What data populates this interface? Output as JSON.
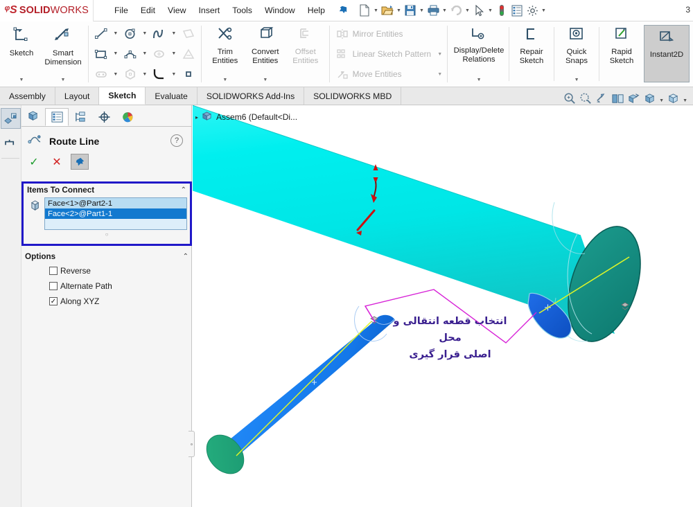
{
  "app": {
    "brand_ds": "2DS",
    "brand_solid": "SOLID",
    "brand_works": "WORKS",
    "far_right_label": "3"
  },
  "menubar": {
    "items": [
      {
        "label": "File",
        "name": "menu-file"
      },
      {
        "label": "Edit",
        "name": "menu-edit"
      },
      {
        "label": "View",
        "name": "menu-view"
      },
      {
        "label": "Insert",
        "name": "menu-insert"
      },
      {
        "label": "Tools",
        "name": "menu-tools"
      },
      {
        "label": "Window",
        "name": "menu-window"
      },
      {
        "label": "Help",
        "name": "menu-help"
      }
    ],
    "pin_icon": "pin-icon",
    "quick_access": [
      {
        "name": "new-document-icon",
        "caret": true
      },
      {
        "name": "open-document-icon",
        "caret": true
      },
      {
        "name": "save-icon",
        "caret": true
      },
      {
        "name": "print-icon",
        "caret": true
      },
      {
        "name": "undo-icon",
        "caret": true
      },
      {
        "name": "select-cursor-icon",
        "caret": true
      },
      {
        "name": "rebuild-traffic-light-icon",
        "caret": false
      },
      {
        "name": "file-properties-icon",
        "caret": false
      },
      {
        "name": "options-gear-icon",
        "caret": true
      }
    ]
  },
  "ribbon": {
    "sketch_group": [
      {
        "label": "Sketch",
        "icon": "sketch-icon",
        "caret": true,
        "dim": false
      },
      {
        "label": "Smart\nDimension",
        "icon": "smart-dimension-icon",
        "caret": true,
        "dim": false
      }
    ],
    "entity_icons": [
      {
        "name": "line-icon",
        "caret": true,
        "dim": false
      },
      {
        "name": "rectangle-icon",
        "caret": true,
        "dim": false
      },
      {
        "name": "slot-icon",
        "caret": true,
        "dim": true
      },
      {
        "name": "circle-icon",
        "caret": true,
        "dim": false
      },
      {
        "name": "arc-icon",
        "caret": true,
        "dim": false
      },
      {
        "name": "polygon-icon",
        "caret": true,
        "dim": true
      },
      {
        "name": "spline-icon",
        "caret": true,
        "dim": false
      },
      {
        "name": "ellipse-icon",
        "caret": true,
        "dim": true
      },
      {
        "name": "fillet-icon",
        "caret": true,
        "dim": false
      },
      {
        "name": "plane-icon",
        "caret": false,
        "dim": true
      },
      {
        "name": "point-icon",
        "caret": false,
        "dim": true
      },
      {
        "name": "sketch-pattern-square-icon",
        "caret": false,
        "dim": false
      }
    ],
    "tools_group": [
      {
        "label": "Trim\nEntities",
        "icon": "trim-entities-icon",
        "caret": true,
        "dim": false
      },
      {
        "label": "Convert\nEntities",
        "icon": "convert-entities-icon",
        "caret": true,
        "dim": false
      },
      {
        "label": "Offset\nEntities",
        "icon": "offset-entities-icon",
        "caret": false,
        "dim": true
      }
    ],
    "text_commands": [
      {
        "label": "Mirror Entities",
        "icon": "mirror-entities-icon",
        "caret": false
      },
      {
        "label": "Linear Sketch Pattern",
        "icon": "linear-sketch-pattern-icon",
        "caret": true
      },
      {
        "label": "Move Entities",
        "icon": "move-entities-icon",
        "caret": true
      }
    ],
    "right_group": [
      {
        "label": "Display/Delete\nRelations",
        "icon": "display-delete-relations-icon",
        "caret": true,
        "selected": false
      },
      {
        "label": "Repair\nSketch",
        "icon": "repair-sketch-icon",
        "caret": false,
        "selected": false
      },
      {
        "label": "Quick\nSnaps",
        "icon": "quick-snaps-icon",
        "caret": true,
        "selected": false
      },
      {
        "label": "Rapid\nSketch",
        "icon": "rapid-sketch-icon",
        "caret": false,
        "selected": false
      },
      {
        "label": "Instant2D",
        "icon": "instant2d-icon",
        "caret": false,
        "selected": true
      }
    ]
  },
  "tabs": [
    {
      "label": "Assembly",
      "active": false
    },
    {
      "label": "Layout",
      "active": false
    },
    {
      "label": "Sketch",
      "active": true
    },
    {
      "label": "Evaluate",
      "active": false
    },
    {
      "label": "SOLIDWORKS Add-Ins",
      "active": false
    },
    {
      "label": "SOLIDWORKS MBD",
      "active": false
    }
  ],
  "property_manager": {
    "sidebar_buttons": [
      {
        "name": "sidebar-assembly-icon",
        "selected": true
      },
      {
        "name": "sidebar-flyout-tree-icon",
        "selected": false
      }
    ],
    "tabs": [
      {
        "name": "feature-manager-tab",
        "icon": "feature-tree-icon",
        "selected": false
      },
      {
        "name": "property-manager-tab",
        "icon": "property-list-icon",
        "selected": true
      },
      {
        "name": "configuration-manager-tab",
        "icon": "configuration-icon",
        "selected": false
      },
      {
        "name": "dimxpert-manager-tab",
        "icon": "dimxpert-icon",
        "selected": false
      },
      {
        "name": "display-manager-tab",
        "icon": "display-palette-icon",
        "selected": false
      }
    ],
    "title": "Route Line",
    "title_icon": "route-line-icon",
    "help_icon": "help-question-icon",
    "actions": [
      {
        "name": "ok-button",
        "glyph": "✓"
      },
      {
        "name": "cancel-button",
        "glyph": "✕"
      },
      {
        "name": "keep-visible-pin-button",
        "glyph": "✐"
      }
    ],
    "items_to_connect": {
      "header": "Items To Connect",
      "collapse_chevron": "⌃",
      "icon": "selection-face-icon",
      "selections": [
        {
          "label": "Face<1>@Part2-1",
          "state": "selected-light"
        },
        {
          "label": "Face<2>@Part1-1",
          "state": "selected-active"
        },
        {
          "label": "",
          "state": "empty"
        }
      ]
    },
    "options": {
      "header": "Options",
      "collapse_chevron": "⌃",
      "checkboxes": [
        {
          "label": "Reverse",
          "checked": false
        },
        {
          "label": "Alternate Path",
          "checked": false
        },
        {
          "label": "Along XYZ",
          "checked": true
        }
      ]
    }
  },
  "viewport": {
    "tree_root": "Assem6  (Default<Di...",
    "tree_root_icon": "assembly-icon",
    "tree_expand_arrow": "▸",
    "view_toolbar": [
      {
        "name": "zoom-to-fit-icon",
        "caret": false
      },
      {
        "name": "zoom-to-area-icon",
        "caret": false
      },
      {
        "name": "previous-view-icon",
        "caret": false
      },
      {
        "name": "section-view-icon",
        "caret": false
      },
      {
        "name": "view-orientation-icon",
        "caret": false
      },
      {
        "name": "display-style-icon",
        "caret": true
      },
      {
        "name": "hide-show-items-icon",
        "caret": true
      }
    ],
    "annotation_lines": [
      "انتخاب قطعه انتقالی و محل",
      "اصلی قرار گیری"
    ],
    "colors": {
      "large_cylinder_body": "#00ecec",
      "large_cylinder_cap": "#17897f",
      "small_cylinder_body": "#1a7ff0",
      "small_cylinder_cap": "#2db07a",
      "selected_face": "#1565e8",
      "route_line": "#d723d7",
      "axis_line": "#dbf52a",
      "annotation_text": "#3a1f8f",
      "dimension_arrow": "#d00000"
    }
  }
}
